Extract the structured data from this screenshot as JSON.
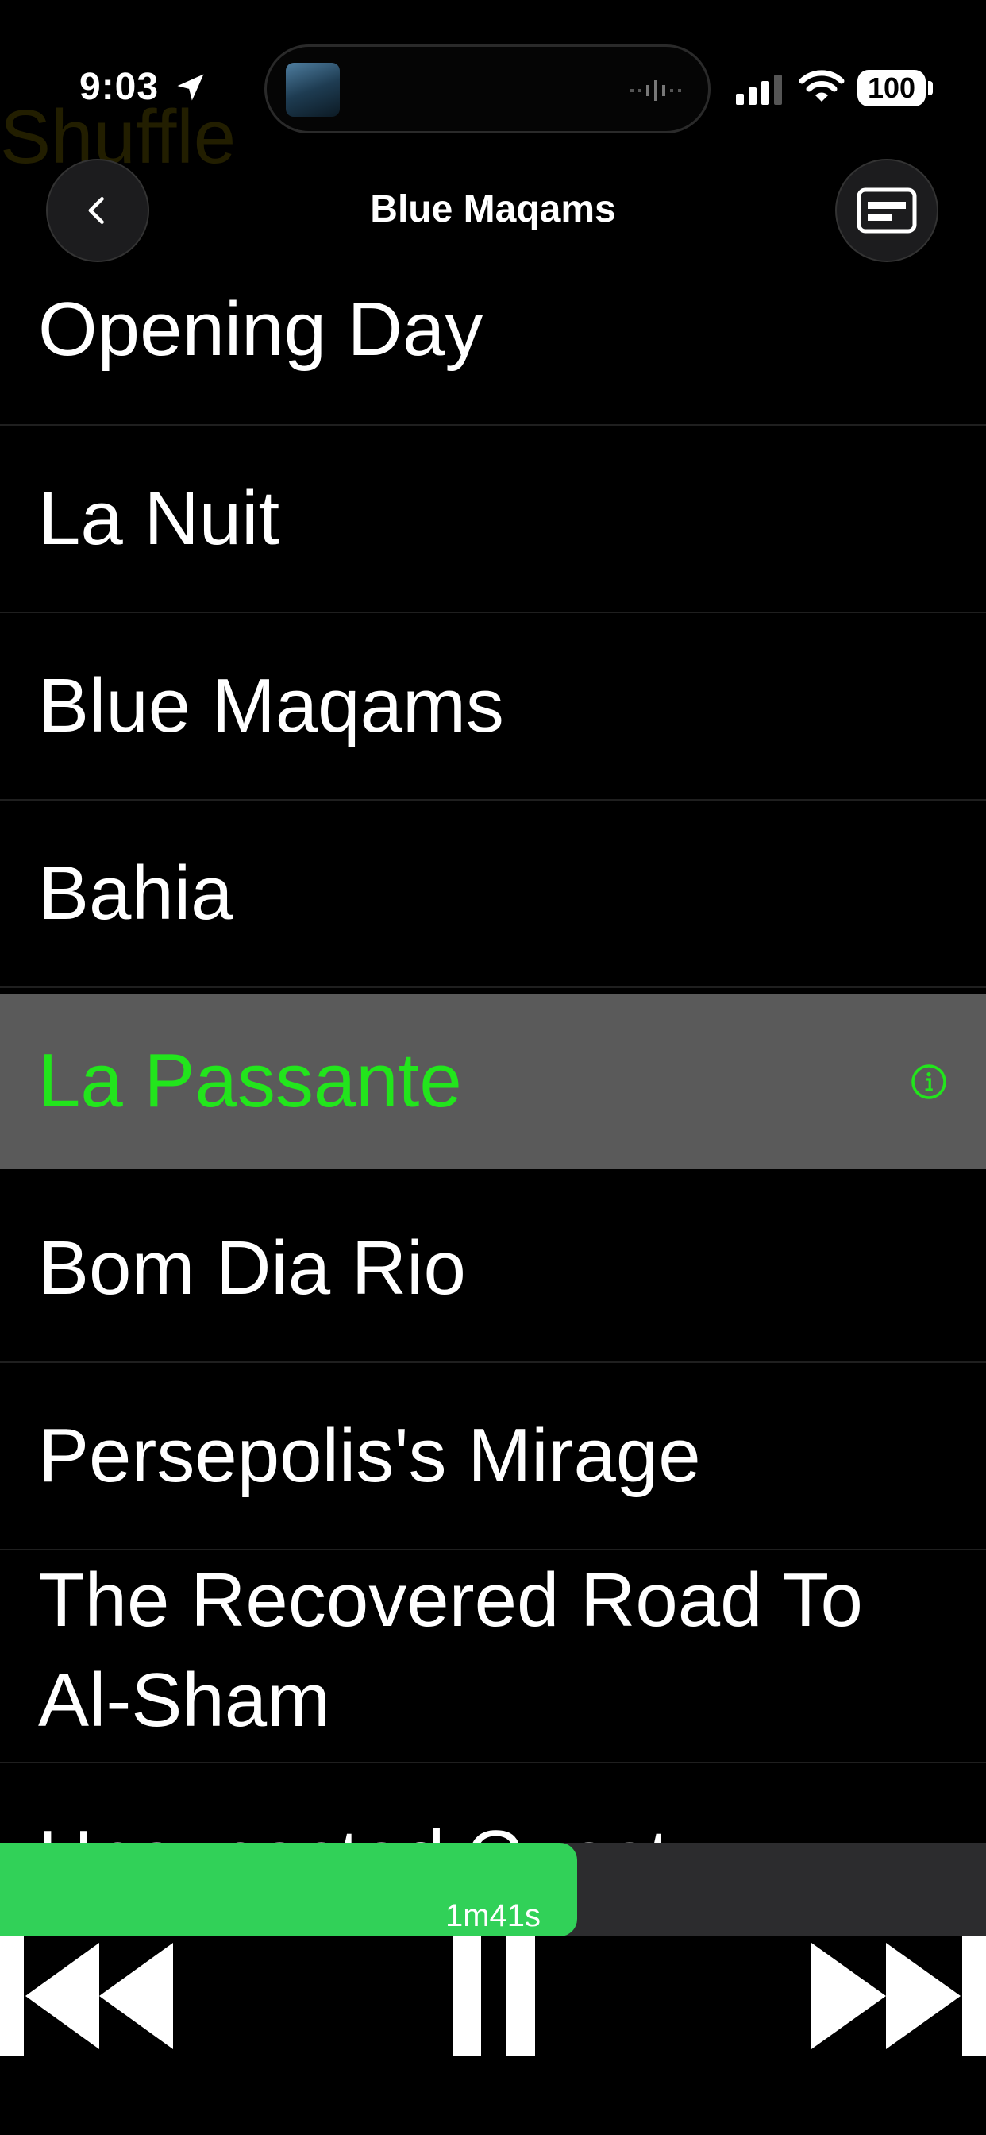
{
  "status": {
    "time": "9:03",
    "battery": "100",
    "icons": [
      "location-arrow-icon",
      "cellular-signal-icon",
      "wifi-icon",
      "battery-icon"
    ]
  },
  "ghost_text": "Shuffle",
  "header": {
    "title": "Blue Maqams",
    "back_icon": "chevron-left-icon",
    "card_icon": "card-icon"
  },
  "tracks": [
    {
      "title": "Opening Day"
    },
    {
      "title": "La Nuit"
    },
    {
      "title": "Blue Maqams"
    },
    {
      "title": "Bahia"
    },
    {
      "title": "La Passante",
      "selected": true
    },
    {
      "title": "Bom Dia Rio"
    },
    {
      "title": "Persepolis's Mirage"
    },
    {
      "title": "The Recovered Road To Al-Sham"
    },
    {
      "title": "Unexpected Guest"
    }
  ],
  "playback": {
    "elapsed_label": "1m41s",
    "progress_fraction": 0.585
  },
  "colors": {
    "accent_green": "#22e51c",
    "progress_green": "#31d158",
    "selected_row": "#5a5a5a",
    "background": "#000000"
  },
  "controls": [
    "rewind-icon",
    "pause-icon",
    "fast-forward-icon"
  ]
}
